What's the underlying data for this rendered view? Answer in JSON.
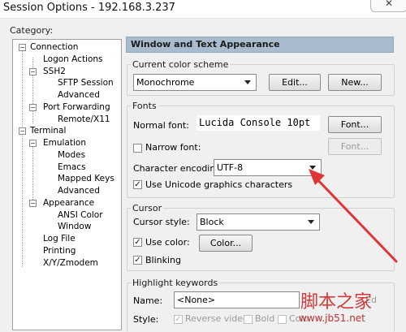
{
  "window": {
    "title": "Session Options - 192.168.3.237",
    "close_icon": "close-icon"
  },
  "category": {
    "label": "Category:",
    "tree": [
      {
        "label": "Connection",
        "expander": "−"
      },
      {
        "label": "Logon Actions"
      },
      {
        "label": "SSH2",
        "expander": "−"
      },
      {
        "label": "SFTP Session"
      },
      {
        "label": "Advanced"
      },
      {
        "label": "Port Forwarding",
        "expander": "−"
      },
      {
        "label": "Remote/X11"
      },
      {
        "label": "Terminal",
        "expander": "−"
      },
      {
        "label": "Emulation",
        "expander": "−"
      },
      {
        "label": "Modes"
      },
      {
        "label": "Emacs"
      },
      {
        "label": "Mapped Keys"
      },
      {
        "label": "Advanced"
      },
      {
        "label": "Appearance",
        "expander": "−"
      },
      {
        "label": "ANSI Color"
      },
      {
        "label": "Window"
      },
      {
        "label": "Log File"
      },
      {
        "label": "Printing"
      },
      {
        "label": "X/Y/Zmodem"
      }
    ]
  },
  "panel": {
    "header": "Window and Text Appearance",
    "color_scheme": {
      "group": "Current color scheme",
      "value": "Monochrome",
      "edit_label": "Edit...",
      "new_label": "New..."
    },
    "fonts": {
      "group": "Fonts",
      "normal_font_label": "Normal font:",
      "normal_font_value": "Lucida Console 10pt",
      "font_button_label": "Font...",
      "narrow_font_label": "Narrow font:",
      "narrow_font_button_label": "Font...",
      "encoding_label": "Character encoding:",
      "encoding_value": "UTF-8",
      "unicode_label": "Use Unicode graphics characters",
      "narrow_checked": false,
      "unicode_checked": true
    },
    "cursor": {
      "group": "Cursor",
      "style_label": "Cursor style:",
      "style_value": "Block",
      "use_color_label": "Use color:",
      "color_button_label": "Color...",
      "blinking_label": "Blinking",
      "use_color_checked": true,
      "blinking_checked": true
    },
    "highlight": {
      "group": "Highlight keywords",
      "name_label": "Name:",
      "name_value": "<None>",
      "edit_fragment": "Ed",
      "style_label": "Style:",
      "reverse_label": "Reverse video",
      "bold_label": "Bold",
      "color_fragment": "Colo"
    }
  },
  "watermark": {
    "text_cn": "脚本之家",
    "url": "www.jb51.net"
  },
  "colors": {
    "header_bg": "#a9bccf",
    "annotation_arrow": "#e03535"
  }
}
